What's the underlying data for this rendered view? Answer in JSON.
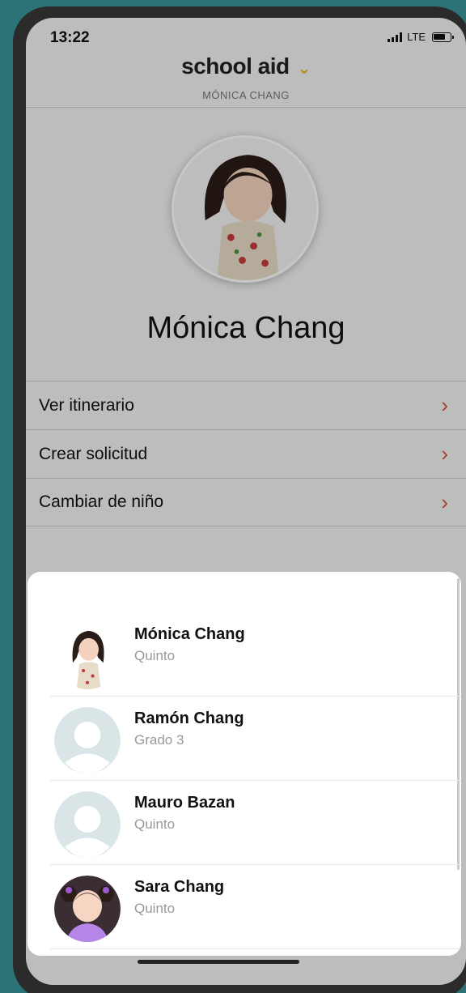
{
  "status_bar": {
    "time": "13:22",
    "network": "LTE"
  },
  "header": {
    "brand": "school aid",
    "subtitle": "MÓNICA CHANG"
  },
  "profile": {
    "name": "Mónica Chang"
  },
  "menu": {
    "items": [
      {
        "label": "Ver itinerario"
      },
      {
        "label": "Crear solicitud"
      },
      {
        "label": "Cambiar de niño"
      }
    ]
  },
  "children_sheet": {
    "children": [
      {
        "name": "Mónica Chang",
        "grade": "Quinto",
        "avatar": "photo-girl-floral-dress"
      },
      {
        "name": "Ramón Chang",
        "grade": "Grado 3",
        "avatar": "default-person-icon"
      },
      {
        "name": "Mauro Bazan",
        "grade": "Quinto",
        "avatar": "default-person-icon"
      },
      {
        "name": "Sara Chang",
        "grade": "Quinto",
        "avatar": "photo-girl-pigtails"
      }
    ]
  },
  "colors": {
    "accent_chevron": "#d9503c",
    "brand_chevron": "#e8b21a",
    "background": "#2c7378"
  }
}
